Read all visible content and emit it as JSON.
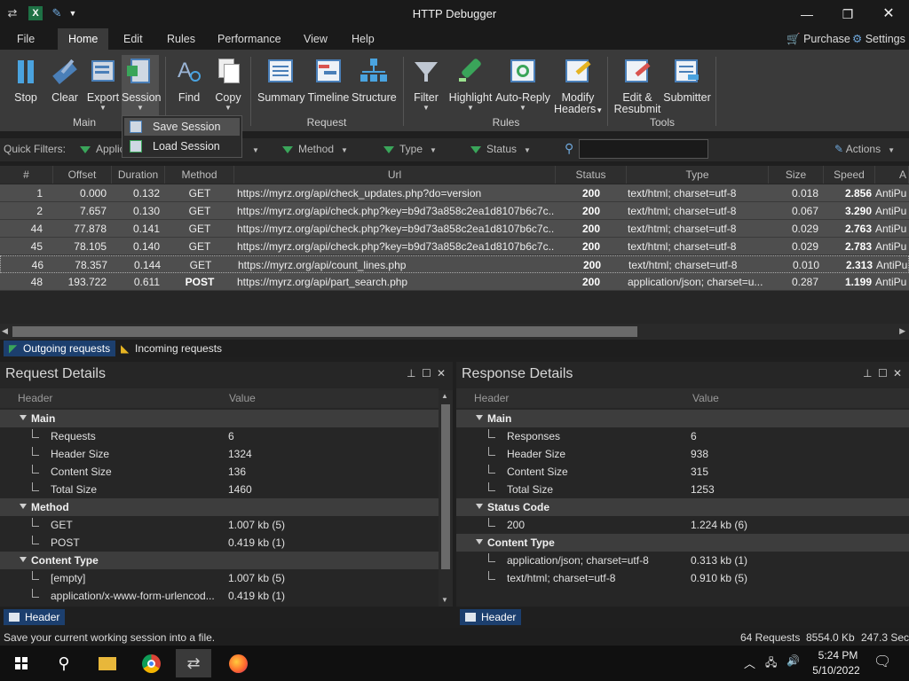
{
  "app": {
    "title": "HTTP Debugger"
  },
  "menu": {
    "tabs": [
      "File",
      "Home",
      "Edit",
      "Rules",
      "Performance",
      "View",
      "Help"
    ],
    "purchase": "Purchase",
    "settings": "Settings"
  },
  "ribbon": {
    "main": {
      "group": "Main",
      "stop": "Stop",
      "clear": "Clear",
      "export": "Export",
      "session": "Session"
    },
    "find": "Find",
    "copy": "Copy",
    "request": {
      "group": "Request",
      "summary": "Summary",
      "timeline": "Timeline",
      "structure": "Structure"
    },
    "rules": {
      "group": "Rules",
      "filter": "Filter",
      "highlight": "Highlight",
      "autoreply": "Auto-Reply",
      "modify1": "Modify",
      "modify2": "Headers"
    },
    "tools": {
      "group": "Tools",
      "edit1": "Edit &",
      "edit2": "Resubmit",
      "submitter": "Submitter"
    }
  },
  "session_menu": {
    "items": [
      "Save Session",
      "Load Session"
    ]
  },
  "quick_filters": {
    "label": "Quick Filters:",
    "application": "Applic",
    "method": "Method",
    "type": "Type",
    "status": "Status",
    "actions": "Actions"
  },
  "grid": {
    "columns": [
      "#",
      "Offset",
      "Duration",
      "Method",
      "Url",
      "Status",
      "Type",
      "Size",
      "Speed",
      "A"
    ],
    "rows": [
      {
        "n": "1",
        "offset": "0.000",
        "duration": "0.132",
        "method": "GET",
        "url": "https://myrz.org/api/check_updates.php?do=version",
        "status": "200",
        "type": "text/html; charset=utf-8",
        "size": "0.018",
        "speed": "2.856",
        "app": "AntiPu"
      },
      {
        "n": "2",
        "offset": "7.657",
        "duration": "0.130",
        "method": "GET",
        "url": "https://myrz.org/api/check.php?key=b9d73a858c2ea1d8107b6c7c...",
        "status": "200",
        "type": "text/html; charset=utf-8",
        "size": "0.067",
        "speed": "3.290",
        "app": "AntiPu"
      },
      {
        "n": "44",
        "offset": "77.878",
        "duration": "0.141",
        "method": "GET",
        "url": "https://myrz.org/api/check.php?key=b9d73a858c2ea1d8107b6c7c...",
        "status": "200",
        "type": "text/html; charset=utf-8",
        "size": "0.029",
        "speed": "2.763",
        "app": "AntiPu"
      },
      {
        "n": "45",
        "offset": "78.105",
        "duration": "0.140",
        "method": "GET",
        "url": "https://myrz.org/api/check.php?key=b9d73a858c2ea1d8107b6c7c...",
        "status": "200",
        "type": "text/html; charset=utf-8",
        "size": "0.029",
        "speed": "2.783",
        "app": "AntiPu"
      },
      {
        "n": "46",
        "offset": "78.357",
        "duration": "0.144",
        "method": "GET",
        "url": "https://myrz.org/api/count_lines.php",
        "status": "200",
        "type": "text/html; charset=utf-8",
        "size": "0.010",
        "speed": "2.313",
        "app": "AntiPu"
      },
      {
        "n": "48",
        "offset": "193.722",
        "duration": "0.611",
        "method": "POST",
        "url": "https://myrz.org/api/part_search.php",
        "status": "200",
        "type": "application/json; charset=u...",
        "size": "0.287",
        "speed": "1.199",
        "app": "AntiPu"
      }
    ]
  },
  "req_tabs": {
    "outgoing": "Outgoing requests",
    "incoming": "Incoming requests"
  },
  "request_details": {
    "title": "Request Details",
    "col_header": "Header",
    "col_value": "Value",
    "main": "Main",
    "requests": "Requests",
    "requests_v": "6",
    "header_size": "Header Size",
    "header_size_v": "1324",
    "content_size": "Content Size",
    "content_size_v": "136",
    "total_size": "Total Size",
    "total_size_v": "1460",
    "method": "Method",
    "get": "GET",
    "get_v": "1.007 kb (5)",
    "post": "POST",
    "post_v": "0.419 kb (1)",
    "content_type": "Content Type",
    "empty": "[empty]",
    "empty_v": "1.007 kb (5)",
    "form": "application/x-www-form-urlencod...",
    "form_v": "0.419 kb (1)",
    "tab": "Header"
  },
  "response_details": {
    "title": "Response Details",
    "col_header": "Header",
    "col_value": "Value",
    "main": "Main",
    "responses": "Responses",
    "responses_v": "6",
    "header_size": "Header Size",
    "header_size_v": "938",
    "content_size": "Content Size",
    "content_size_v": "315",
    "total_size": "Total Size",
    "total_size_v": "1253",
    "status_code": "Status Code",
    "s200": "200",
    "s200_v": "1.224 kb (6)",
    "content_type": "Content Type",
    "json": "application/json; charset=utf-8",
    "json_v": "0.313 kb (1)",
    "html": "text/html; charset=utf-8",
    "html_v": "0.910 kb (5)",
    "tab": "Header"
  },
  "status_bar": {
    "message": "Save your current working session into a file.",
    "requests": "64 Requests",
    "kb": "8554.0 Kb",
    "sec": "247.3 Sec"
  },
  "taskbar": {
    "time": "5:24 PM",
    "date": "5/10/2022"
  },
  "colors": {
    "accent": "#1c3f6e",
    "ribbon": "#3a3a3a",
    "row": "#4e4e4e"
  }
}
